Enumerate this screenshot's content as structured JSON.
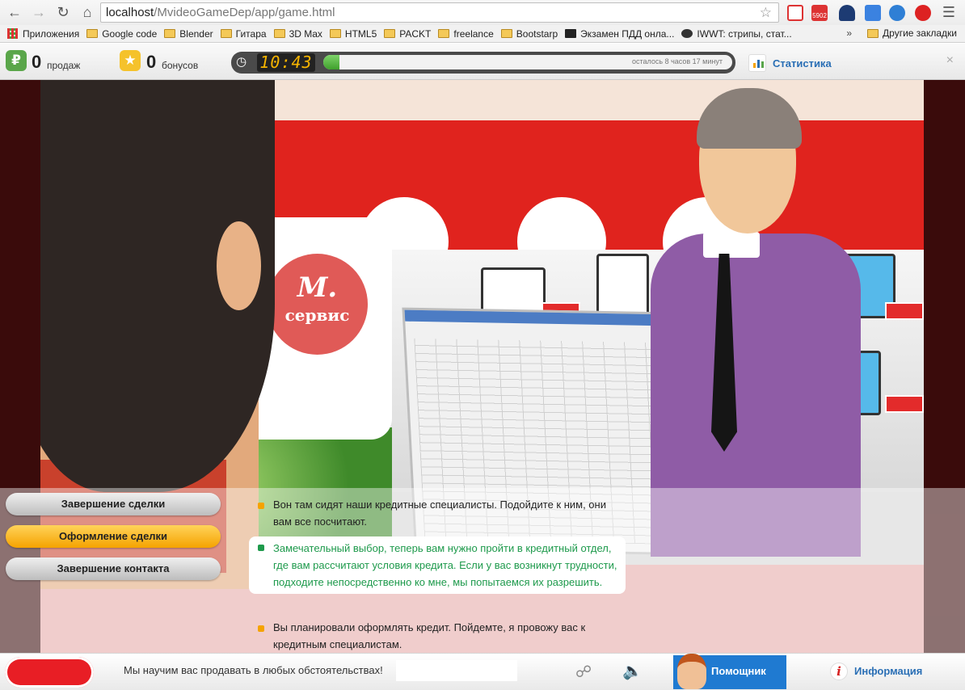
{
  "browser": {
    "address_host": "localhost",
    "address_path": "/MvideoGameDep/app/game.html",
    "back_icon": "back-arrow-icon",
    "forward_icon": "forward-arrow-icon",
    "reload_icon": "reload-icon",
    "home_icon": "home-icon",
    "ext_badge": "5902"
  },
  "bookmarks": {
    "apps": "Приложения",
    "items": [
      "Google code",
      "Blender",
      "Гитара",
      "3D Max",
      "HTML5",
      "PACKT",
      "freelance",
      "Bootstarp",
      "Экзамен ПДД онла...",
      "IWWT: стрипы, стат..."
    ],
    "overflow": "»",
    "other": "Другие закладки"
  },
  "game": {
    "sales_count": "0",
    "sales_label": "продаж",
    "bonus_count": "0",
    "bonus_label": "бонусов",
    "timer": "10:43",
    "time_progress": 0.04,
    "time_left": "осталось 8 часов 17 минут",
    "stats_label": "Статистика",
    "close": "×"
  },
  "scene": {
    "logo_m": "М.",
    "logo_service": "сервис"
  },
  "choices": [
    {
      "label": "Завершение сделки",
      "active": false
    },
    {
      "label": "Оформление сделки",
      "active": true
    },
    {
      "label": "Завершение контакта",
      "active": false
    }
  ],
  "replies": [
    "Вон там сидят наши кредитные специалисты. Подойдите к ним, они вам все посчитают.",
    "Замечательный выбор, теперь вам нужно пройти в кредитный отдел, где вам рассчитают условия кредита. Если у вас возникнут трудности, подходите непосредственно ко мне, мы попытаемся их разрешить.",
    "Вы планировали оформлять кредит. Пойдемте, я провожу вас к кредитным специалистам."
  ],
  "bottom": {
    "tip": "Мы научим вас продавать в любых обстоятельствах!",
    "helper_label": "Помощник",
    "info_label": "Информация"
  },
  "colors": {
    "accent_orange": "#f5a300",
    "accent_green": "#1e9a4c",
    "brand_red": "#e0231e",
    "link_blue": "#2a6fb5"
  }
}
